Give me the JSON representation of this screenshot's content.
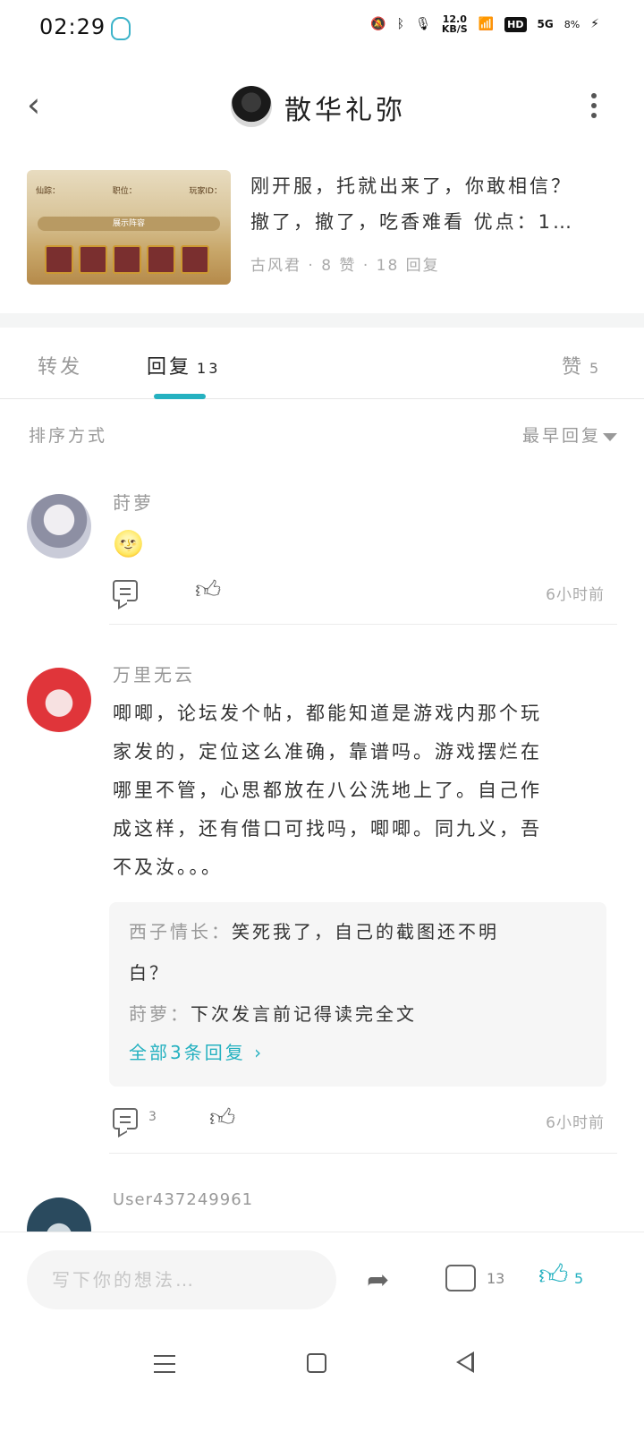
{
  "status_bar": {
    "time": "02:29",
    "net_speed_value": "12.0",
    "net_speed_unit": "KB/S",
    "hd": "HD",
    "signal": "5G",
    "battery": "8%"
  },
  "header": {
    "title": "散华礼弥"
  },
  "post": {
    "thumb_labels": [
      "仙踪：",
      "职位：",
      "玩家ID："
    ],
    "thumb_bar": "展示阵容",
    "line1": "刚开服，托就出来了，你敢相信？",
    "line2": "撤了，撤了，吃香难看 优点：1…",
    "meta": "古风君 · 8 赞 · 18 回复"
  },
  "tabs": {
    "forward": "转发",
    "reply": "回复",
    "reply_count": "13",
    "like": "赞",
    "like_count": "5"
  },
  "sort": {
    "label": "排序方式",
    "value": "最早回复"
  },
  "comments": [
    {
      "name": "莳萝",
      "text": "🌝",
      "time": "6小时前",
      "reply_count": "",
      "avatar_color": "#c9cbd8"
    },
    {
      "name": "万里无云",
      "text_lines": [
        "唧唧，论坛发个帖，都能知道是游戏内那个玩",
        "家发的，定位这么准确，靠谱吗。游戏摆烂在",
        "哪里不管，心思都放在八公洗地上了。自己作",
        "成这样，还有借口可找吗，唧唧。同九义，吾",
        "不及汝。。。"
      ],
      "sub_replies": [
        {
          "who": "西子情长：",
          "text": "笑死我了，自己的截图还不明",
          "text2": "白？"
        },
        {
          "who": "莳萝：",
          "text": "下次发言前记得读完全文"
        }
      ],
      "sub_more": "全部3条回复",
      "time": "6小时前",
      "reply_count": "3",
      "avatar_color": "#e0353a"
    },
    {
      "name": "User437249961",
      "avatar_color": "#2a4a5e"
    }
  ],
  "bottom_bar": {
    "input_placeholder": "写下你的想法…",
    "comment_count": "13",
    "like_count": "5"
  },
  "colors": {
    "accent": "#25b1c0"
  }
}
